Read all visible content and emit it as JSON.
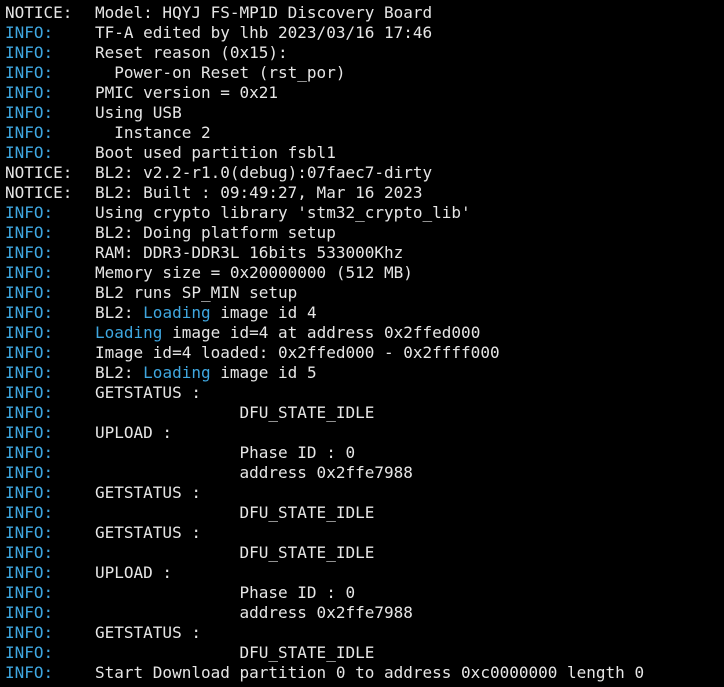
{
  "terminal": {
    "colors": {
      "background": "#000000",
      "foreground": "#e6e6e6",
      "info": "#3fa7e0",
      "highlight": "#3fa7e0"
    },
    "lines": [
      {
        "level": "NOTICE:",
        "kind": "notice",
        "segments": [
          {
            "t": "Model: HQYJ FS-MP1D Discovery Board",
            "hl": false
          }
        ]
      },
      {
        "level": "INFO:",
        "kind": "info",
        "segments": [
          {
            "t": "TF-A edited by lhb 2023/03/16 17:46",
            "hl": false
          }
        ]
      },
      {
        "level": "INFO:",
        "kind": "info",
        "segments": [
          {
            "t": "Reset reason (0x15):",
            "hl": false
          }
        ]
      },
      {
        "level": "INFO:",
        "kind": "info",
        "segments": [
          {
            "t": "  Power-on Reset (rst_por)",
            "hl": false
          }
        ]
      },
      {
        "level": "INFO:",
        "kind": "info",
        "segments": [
          {
            "t": "PMIC version = 0x21",
            "hl": false
          }
        ]
      },
      {
        "level": "INFO:",
        "kind": "info",
        "segments": [
          {
            "t": "Using USB",
            "hl": false
          }
        ]
      },
      {
        "level": "INFO:",
        "kind": "info",
        "segments": [
          {
            "t": "  Instance 2",
            "hl": false
          }
        ]
      },
      {
        "level": "INFO:",
        "kind": "info",
        "segments": [
          {
            "t": "Boot used partition fsbl1",
            "hl": false
          }
        ]
      },
      {
        "level": "NOTICE:",
        "kind": "notice",
        "segments": [
          {
            "t": "BL2: v2.2-r1.0(debug):07faec7-dirty",
            "hl": false
          }
        ]
      },
      {
        "level": "NOTICE:",
        "kind": "notice",
        "segments": [
          {
            "t": "BL2: Built : 09:49:27, Mar 16 2023",
            "hl": false
          }
        ]
      },
      {
        "level": "INFO:",
        "kind": "info",
        "segments": [
          {
            "t": "Using crypto library 'stm32_crypto_lib'",
            "hl": false
          }
        ]
      },
      {
        "level": "INFO:",
        "kind": "info",
        "segments": [
          {
            "t": "BL2: Doing platform setup",
            "hl": false
          }
        ]
      },
      {
        "level": "INFO:",
        "kind": "info",
        "segments": [
          {
            "t": "RAM: DDR3-DDR3L 16bits 533000Khz",
            "hl": false
          }
        ]
      },
      {
        "level": "INFO:",
        "kind": "info",
        "segments": [
          {
            "t": "Memory size = 0x20000000 (512 MB)",
            "hl": false
          }
        ]
      },
      {
        "level": "INFO:",
        "kind": "info",
        "segments": [
          {
            "t": "BL2 runs SP_MIN setup",
            "hl": false
          }
        ]
      },
      {
        "level": "INFO:",
        "kind": "info",
        "segments": [
          {
            "t": "BL2: ",
            "hl": false
          },
          {
            "t": "Loading",
            "hl": true
          },
          {
            "t": " image id 4",
            "hl": false
          }
        ]
      },
      {
        "level": "INFO:",
        "kind": "info",
        "segments": [
          {
            "t": "Loading",
            "hl": true
          },
          {
            "t": " image id=4 at address 0x2ffed000",
            "hl": false
          }
        ]
      },
      {
        "level": "INFO:",
        "kind": "info",
        "segments": [
          {
            "t": "Image id=4 loaded: 0x2ffed000 - 0x2ffff000",
            "hl": false
          }
        ]
      },
      {
        "level": "INFO:",
        "kind": "info",
        "segments": [
          {
            "t": "BL2: ",
            "hl": false
          },
          {
            "t": "Loading",
            "hl": true
          },
          {
            "t": " image id 5",
            "hl": false
          }
        ]
      },
      {
        "level": "INFO:",
        "kind": "info",
        "segments": [
          {
            "t": "GETSTATUS :",
            "hl": false
          }
        ]
      },
      {
        "level": "INFO:",
        "kind": "info",
        "segments": [
          {
            "t": "               DFU_STATE_IDLE",
            "hl": false
          }
        ]
      },
      {
        "level": "INFO:",
        "kind": "info",
        "segments": [
          {
            "t": "UPLOAD :",
            "hl": false
          }
        ]
      },
      {
        "level": "INFO:",
        "kind": "info",
        "segments": [
          {
            "t": "               Phase ID : 0",
            "hl": false
          }
        ]
      },
      {
        "level": "INFO:",
        "kind": "info",
        "segments": [
          {
            "t": "               address 0x2ffe7988",
            "hl": false
          }
        ]
      },
      {
        "level": "INFO:",
        "kind": "info",
        "segments": [
          {
            "t": "GETSTATUS :",
            "hl": false
          }
        ]
      },
      {
        "level": "INFO:",
        "kind": "info",
        "segments": [
          {
            "t": "               DFU_STATE_IDLE",
            "hl": false
          }
        ]
      },
      {
        "level": "INFO:",
        "kind": "info",
        "segments": [
          {
            "t": "GETSTATUS :",
            "hl": false
          }
        ]
      },
      {
        "level": "INFO:",
        "kind": "info",
        "segments": [
          {
            "t": "               DFU_STATE_IDLE",
            "hl": false
          }
        ]
      },
      {
        "level": "INFO:",
        "kind": "info",
        "segments": [
          {
            "t": "UPLOAD :",
            "hl": false
          }
        ]
      },
      {
        "level": "INFO:",
        "kind": "info",
        "segments": [
          {
            "t": "               Phase ID : 0",
            "hl": false
          }
        ]
      },
      {
        "level": "INFO:",
        "kind": "info",
        "segments": [
          {
            "t": "               address 0x2ffe7988",
            "hl": false
          }
        ]
      },
      {
        "level": "INFO:",
        "kind": "info",
        "segments": [
          {
            "t": "GETSTATUS :",
            "hl": false
          }
        ]
      },
      {
        "level": "INFO:",
        "kind": "info",
        "segments": [
          {
            "t": "               DFU_STATE_IDLE",
            "hl": false
          }
        ]
      },
      {
        "level": "INFO:",
        "kind": "info",
        "segments": [
          {
            "t": "Start Download partition 0 to address 0xc0000000 length 0",
            "hl": false
          }
        ]
      }
    ]
  }
}
